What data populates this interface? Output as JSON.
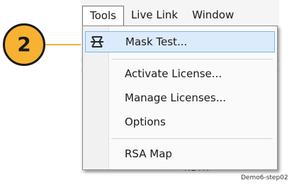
{
  "callout": {
    "number": "2",
    "color": "#f7b232"
  },
  "menubar": {
    "items": [
      {
        "label": "Tools",
        "active": true
      },
      {
        "label": "Live Link",
        "active": false
      },
      {
        "label": "Window",
        "active": false
      }
    ]
  },
  "menu": {
    "items": [
      {
        "label": "Mask Test...",
        "icon": "mask-test-icon",
        "highlighted": true
      },
      {
        "label": "Activate License..."
      },
      {
        "label": "Manage Licenses..."
      },
      {
        "label": "Options"
      },
      {
        "label": "RSA Map"
      }
    ]
  },
  "background": {
    "partial_text": "RBYX"
  },
  "caption": "Demo6-step02",
  "colors": {
    "highlight_fill": "#dcebfb",
    "highlight_border": "#7eb4ea"
  }
}
